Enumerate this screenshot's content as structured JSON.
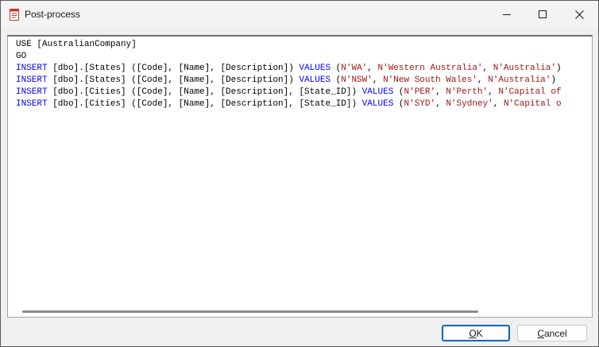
{
  "window": {
    "title": "Post-process",
    "icon": "document-script-icon"
  },
  "controls": {
    "minimize": "minimize-icon",
    "maximize": "maximize-icon",
    "close": "close-icon"
  },
  "editor": {
    "lines": [
      "USE [AustralianCompany]",
      "GO",
      "INSERT [dbo].[States] ([Code], [Name], [Description]) VALUES (N'WA', N'Western Australia', N'Australia')",
      "INSERT [dbo].[States] ([Code], [Name], [Description]) VALUES (N'NSW', N'New South Wales', N'Australia')",
      "INSERT [dbo].[Cities] ([Code], [Name], [Description], [State_ID]) VALUES (N'PER', N'Perth', N'Capital of",
      "INSERT [dbo].[Cities] ([Code], [Name], [Description], [State_ID]) VALUES (N'SYD', N'Sydney', N'Capital o"
    ]
  },
  "buttons": {
    "ok": {
      "mnemonic": "O",
      "rest": "K"
    },
    "cancel": {
      "mnemonic": "C",
      "rest": "ancel"
    }
  },
  "colors": {
    "keyword": "#0000ff",
    "string": "#a31515",
    "default_button_border": "#0067c0"
  }
}
